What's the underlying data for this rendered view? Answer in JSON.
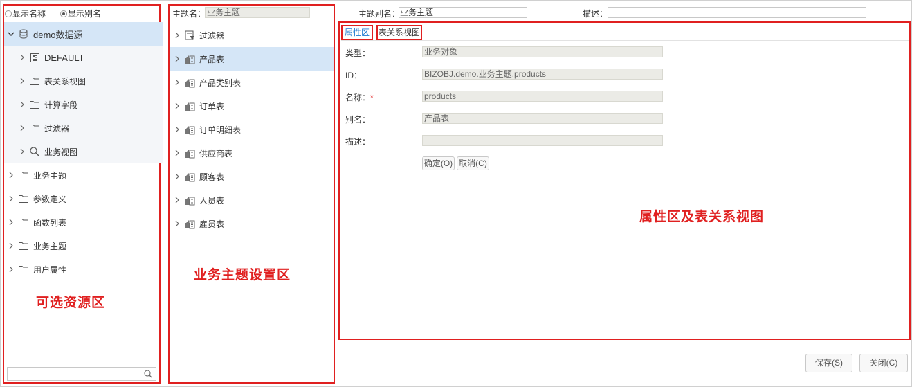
{
  "left_panel": {
    "radio_show_name": "显示名称",
    "radio_show_alias": "显示别名",
    "tree": {
      "root": "demo数据源",
      "children": [
        "DEFAULT",
        "表关系视图",
        "计算字段",
        "过滤器",
        "业务视图"
      ],
      "top": [
        "业务主题",
        "参数定义",
        "函数列表",
        "业务主题",
        "用户属性"
      ]
    },
    "annotation": "可选资源区"
  },
  "middle_panel": {
    "theme_name_label": "主题名：",
    "theme_name_value": "业务主题",
    "items": [
      "过滤器",
      "产品表",
      "产品类别表",
      "订单表",
      "订单明细表",
      "供应商表",
      "顾客表",
      "人员表",
      "雇员表"
    ],
    "annotation": "业务主题设置区"
  },
  "header": {
    "alias_label": "主题别名：",
    "alias_value": "业务主题",
    "desc_label": "描述："
  },
  "right_panel": {
    "tabs": [
      "属性区",
      "表关系视图"
    ],
    "fields": {
      "type_label": "类型：",
      "type_value": "业务对象",
      "id_label": "ID：",
      "id_value": "BIZOBJ.demo.业务主题.products",
      "name_label": "名称：",
      "name_required": "*",
      "name_value": "products",
      "alias_label": "别名：",
      "alias_value": "产品表",
      "desc_label": "描述：",
      "desc_value": ""
    },
    "confirm_label": "确定(O)",
    "cancel_label": "取消(C)",
    "annotation": "属性区及表关系视图"
  },
  "footer": {
    "save_label": "保存(S)",
    "close_label": "关闭(C)"
  },
  "colors": {
    "annotation_red": "#e02020",
    "selection_bg": "#d5e6f7",
    "tab_active": "#1e7bd0"
  }
}
